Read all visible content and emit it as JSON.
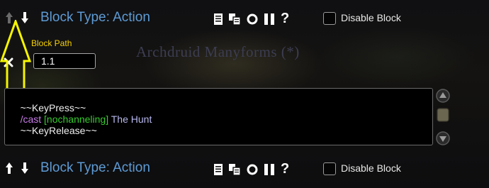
{
  "background": {
    "macro_name": "Archdruid Manyforms (*)"
  },
  "blocks": [
    {
      "type_label": "Block Type: Action",
      "disable_label": "Disable Block",
      "disabled": false,
      "path_label": "Block Path",
      "path_value": "1.1",
      "editor_lines": [
        {
          "segments": [
            {
              "text": "~~KeyPress~~",
              "style": "plain"
            }
          ]
        },
        {
          "segments": [
            {
              "text": "/cast ",
              "style": "cmd"
            },
            {
              "text": "[nochanneling]",
              "style": "cond"
            },
            {
              "text": " The Hunt",
              "style": "spell"
            }
          ]
        },
        {
          "segments": [
            {
              "text": "~~KeyRelease~~",
              "style": "plain"
            }
          ]
        }
      ]
    },
    {
      "type_label": "Block Type: Action",
      "disable_label": "Disable Block",
      "disabled": false
    }
  ],
  "toolbar_icons": [
    "document-icon",
    "copy-icon",
    "loop-icon",
    "pause-icon",
    "help-icon"
  ],
  "help_glyph": "?",
  "colors": {
    "block_type": "#5e9bd5",
    "path_label": "#f6d100",
    "annotation": "#f5f500",
    "slash_command": "#c77be6",
    "conditional": "#37c92f",
    "spell": "#b7b7ee"
  }
}
